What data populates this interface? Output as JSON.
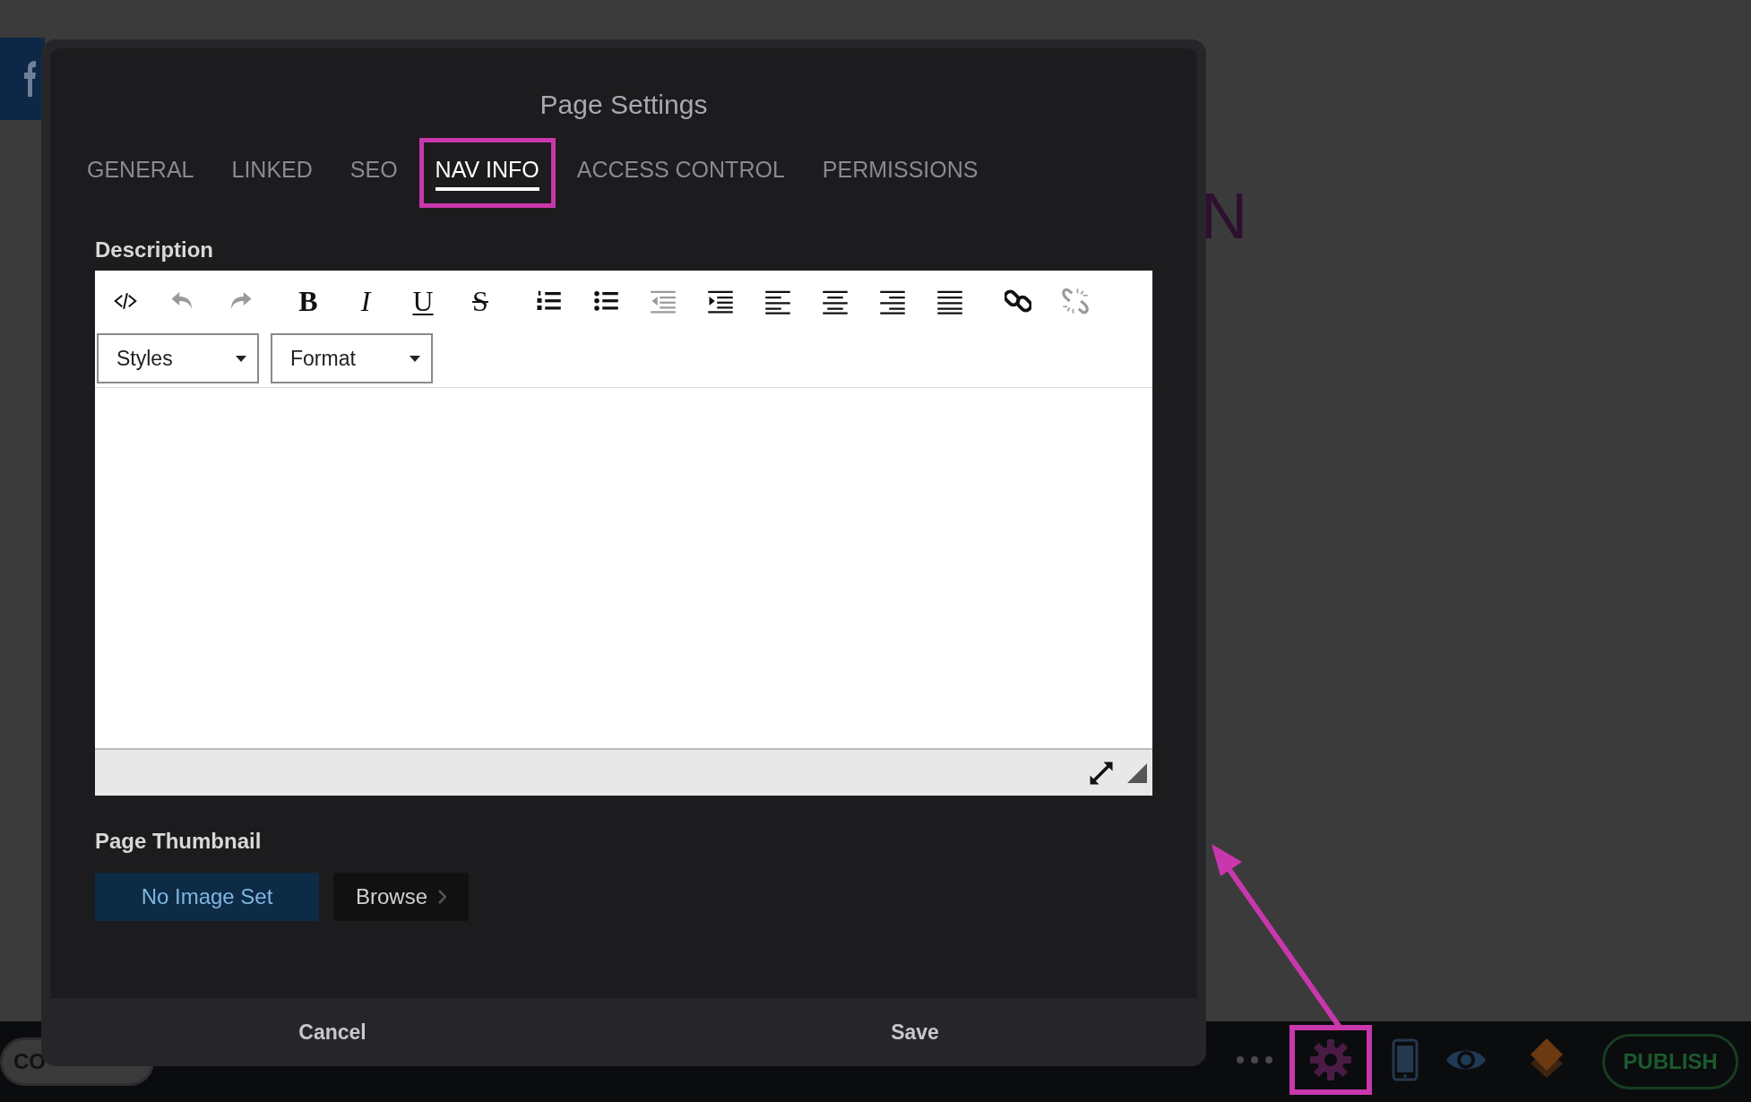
{
  "background": {
    "heading_letter": "N"
  },
  "dialog": {
    "title": "Page Settings",
    "tabs": [
      {
        "label": "GENERAL",
        "selected": false,
        "highlighted": false
      },
      {
        "label": "LINKED",
        "selected": false,
        "highlighted": false
      },
      {
        "label": "SEO",
        "selected": false,
        "highlighted": false
      },
      {
        "label": "NAV INFO",
        "selected": true,
        "highlighted": true
      },
      {
        "label": "ACCESS CONTROL",
        "selected": false,
        "highlighted": false
      },
      {
        "label": "PERMISSIONS",
        "selected": false,
        "highlighted": false
      }
    ],
    "description": {
      "label": "Description",
      "toolbar_groups": [
        [
          {
            "kind": "code",
            "disabled": false
          },
          {
            "kind": "undo",
            "disabled": true
          },
          {
            "kind": "redo",
            "disabled": true
          }
        ],
        [
          {
            "kind": "bold",
            "glyph": "B",
            "disabled": false
          },
          {
            "kind": "italic",
            "glyph": "I",
            "disabled": false
          },
          {
            "kind": "underline",
            "glyph": "U",
            "disabled": false
          },
          {
            "kind": "strike",
            "glyph": "S",
            "disabled": false
          }
        ],
        [
          {
            "kind": "ordered-list",
            "disabled": false
          },
          {
            "kind": "bullet-list",
            "disabled": false
          },
          {
            "kind": "outdent",
            "disabled": true
          },
          {
            "kind": "indent",
            "disabled": false
          },
          {
            "kind": "align-left",
            "disabled": false
          },
          {
            "kind": "align-center",
            "disabled": false
          },
          {
            "kind": "align-right",
            "disabled": false
          },
          {
            "kind": "justify",
            "disabled": false
          }
        ],
        [
          {
            "kind": "link",
            "disabled": false
          },
          {
            "kind": "unlink",
            "disabled": true
          }
        ]
      ],
      "dropdowns": [
        {
          "label": "Styles"
        },
        {
          "label": "Format"
        }
      ]
    },
    "thumbnail": {
      "label": "Page Thumbnail",
      "value": "No Image Set",
      "browse": "Browse"
    },
    "buttons": [
      "Cancel",
      "Save"
    ]
  },
  "bottom_bar": {
    "compose_label": "CO",
    "icons": [
      {
        "kind": "more",
        "highlighted": false
      },
      {
        "kind": "settings",
        "highlighted": true
      },
      {
        "kind": "phone",
        "highlighted": false
      },
      {
        "kind": "preview",
        "highlighted": false
      },
      {
        "kind": "layers",
        "highlighted": false
      }
    ],
    "publish": "PUBLISH"
  }
}
